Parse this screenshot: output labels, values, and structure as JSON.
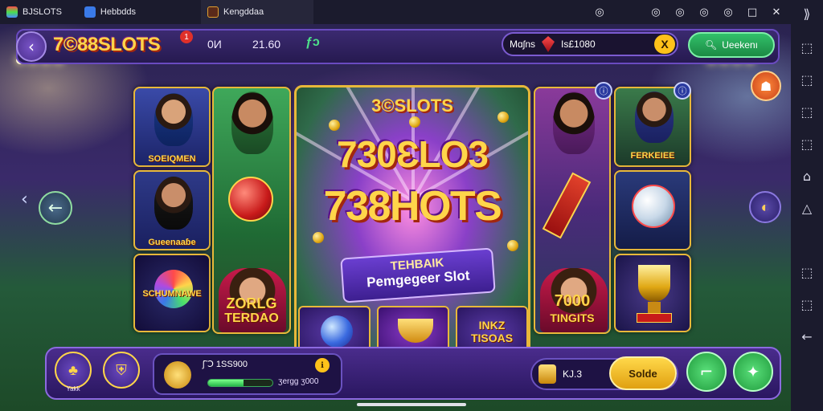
{
  "emulator": {
    "tabs": [
      {
        "label": "BJSLOTS"
      },
      {
        "label": "Hebbdds"
      },
      {
        "label": "Kengddaa"
      }
    ],
    "window_controls": [
      "◎",
      "◎",
      "◎",
      "◎",
      "◎",
      "□",
      "✕"
    ],
    "sidebar_icons": [
      "⟫",
      "⬚",
      "⬚",
      "⬚",
      "⬚",
      "⌂",
      "△",
      "⬚",
      "⬚",
      "←"
    ]
  },
  "header": {
    "back_glyph": "‹",
    "logo": "7©88SLOTS",
    "logo_badge": "1",
    "stat_a": "0И",
    "stat_b": "21.60",
    "stat_icon": "ƒɔ",
    "balance_label": "Mɑʃns",
    "balance_value": "Is£1080",
    "close_glyph": "X",
    "search_label": "Ueekenı"
  },
  "cards": {
    "c1a_label": "SOEIQMEN",
    "c1b_label": "Gueenaaɓe",
    "c1c_label": "SCHUMNAWE",
    "c2c_label_1": "ZORLG",
    "c2c_label_2": "TERDAO",
    "c4a_label": "",
    "c4c_label_1": "7000",
    "c4c_label_2": "TINGITS",
    "c5a_label": "FERKEIEE"
  },
  "center": {
    "small_logo": "3©SLOTS",
    "headline_1": "730ƐLO3",
    "headline_2": "738HOTS",
    "banner_line_1": "TEHBAIK",
    "banner_line_2": "Pemgegeer Slot",
    "mini_labels": [
      "",
      "",
      "INKZ TISOAS"
    ]
  },
  "bottom": {
    "btn1_label": "Yakk",
    "progress_label": "ʃ˜Ↄ 1SS900",
    "progress_sub": "ʒergg ʒ000",
    "progress_fraction": 0.55,
    "coin_amount": "KJ.3",
    "spin_label": "Solde",
    "btn_a_glyph": "⌐",
    "btn_b_glyph": "✦"
  },
  "colors": {
    "accent_gold": "#ffd54a",
    "accent_purple": "#6a4bc0",
    "accent_green": "#31c06a"
  }
}
